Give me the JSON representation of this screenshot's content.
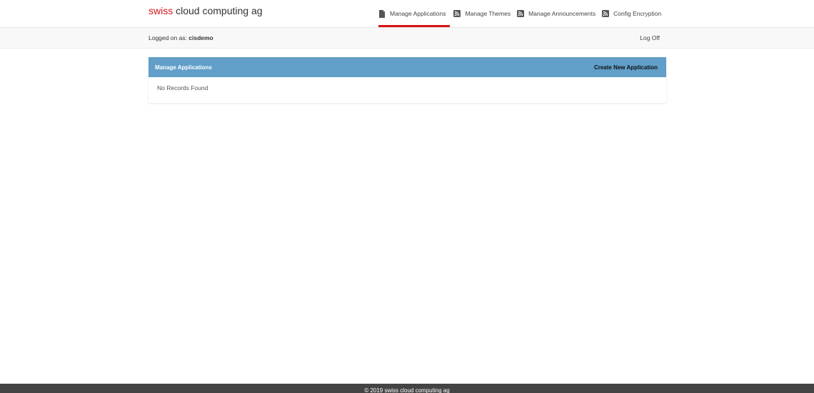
{
  "brand": {
    "accent_text": "swiss",
    "rest_text": " cloud computing ag",
    "accent_color": "#d6141a"
  },
  "nav": {
    "items": [
      {
        "label": "Manage Applications",
        "icon": "document-icon",
        "active": true
      },
      {
        "label": "Manage Themes",
        "icon": "rss-icon",
        "active": false
      },
      {
        "label": "Manage Announcements",
        "icon": "rss-icon",
        "active": false
      },
      {
        "label": "Config Encryption",
        "icon": "rss-icon",
        "active": false
      }
    ]
  },
  "session": {
    "prefix": "Logged on as: ",
    "user": "cisdemo",
    "logoff_label": "Log Off"
  },
  "panel": {
    "title": "Manage Applications",
    "action_label": "Create New Application",
    "empty_text": "No Records Found",
    "header_color": "#619fc9"
  },
  "footer": {
    "text": "© 2019 swiss cloud computing ag"
  }
}
